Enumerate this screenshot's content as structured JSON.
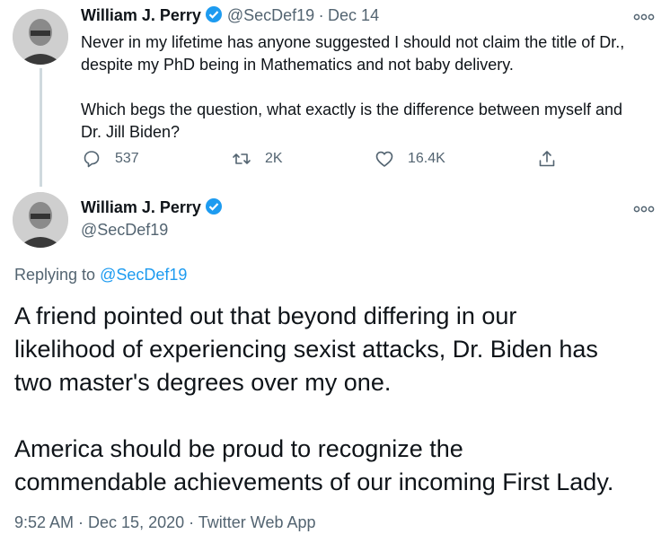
{
  "original_tweet": {
    "author_name": "William J. Perry",
    "author_handle": "@SecDef19",
    "separator": "·",
    "date": "Dec 14",
    "text_line1": "Never in my lifetime has anyone suggested I should not claim the title of Dr.,",
    "text_line2": "despite my PhD being in Mathematics and not baby delivery.",
    "text_line3": "Which begs the question, what exactly is the difference between myself and",
    "text_line4": "Dr. Jill Biden?",
    "replies": "537",
    "retweets": "2K",
    "likes": "16.4K"
  },
  "reply_tweet": {
    "author_name": "William J. Perry",
    "author_handle": "@SecDef19",
    "replying_prefix": "Replying to",
    "replying_handle": "@SecDef19",
    "text_line1": "A friend pointed out that beyond differing in our",
    "text_line2": "likelihood of experiencing sexist attacks, Dr. Biden has",
    "text_line3": "two master's degrees over my one.",
    "text_line4": "America should be proud to recognize the",
    "text_line5": "commendable achievements of our incoming First Lady.",
    "timestamp": "9:52 AM · Dec 15, 2020 · Twitter Web App"
  },
  "colors": {
    "verified": "#1d9bf0",
    "link": "#1d9bf0",
    "secondary_text": "#536471"
  },
  "icons": [
    "verified-badge-icon",
    "more-options-icon",
    "reply-icon",
    "retweet-icon",
    "like-icon",
    "share-icon"
  ]
}
